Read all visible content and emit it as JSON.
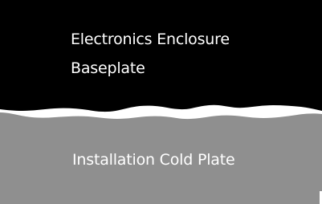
{
  "baseplate": {
    "label_line_1": "Electronics Enclosure",
    "label_line_2": "Baseplate",
    "color": "#000000"
  },
  "cold_plate": {
    "label": "Installation Cold Plate",
    "color": "#8f8f8f"
  },
  "interface_gap": {
    "color": "#ffffff"
  },
  "colors": {
    "text": "#ffffff",
    "background": "#ffffff"
  }
}
